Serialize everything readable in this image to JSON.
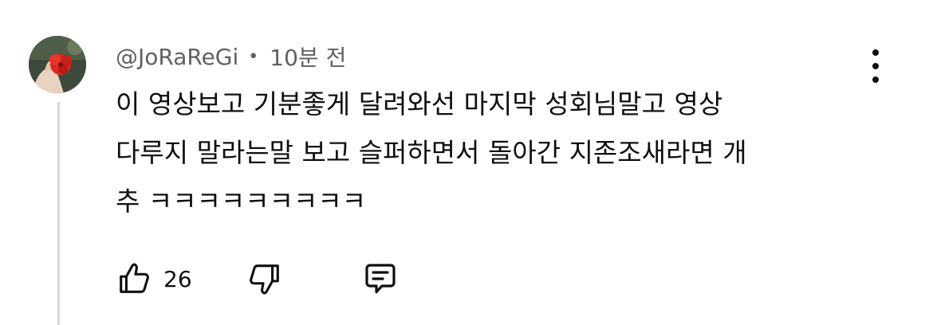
{
  "comment": {
    "author": "@JoRaReGi",
    "separator": "•",
    "timestamp": "10분 전",
    "text_lines": [
      "이 영상보고 기분좋게 달려와선 마지막 성회님말고 영상",
      "다루지 말라는말 보고 슬퍼하면서 돌아간 지존조새라면 개",
      "추 ㅋㅋㅋㅋㅋㅋㅋㅋㅋ"
    ],
    "like_count": "26"
  },
  "icons": {
    "avatar": "avatar-image",
    "more": "more-vertical-icon",
    "like": "thumbs-up-icon",
    "dislike": "thumbs-down-icon",
    "reply": "comment-reply-icon"
  },
  "colors": {
    "text_primary": "#0f0f0f",
    "text_secondary": "#606060",
    "thread_line": "#d9d9d9"
  }
}
